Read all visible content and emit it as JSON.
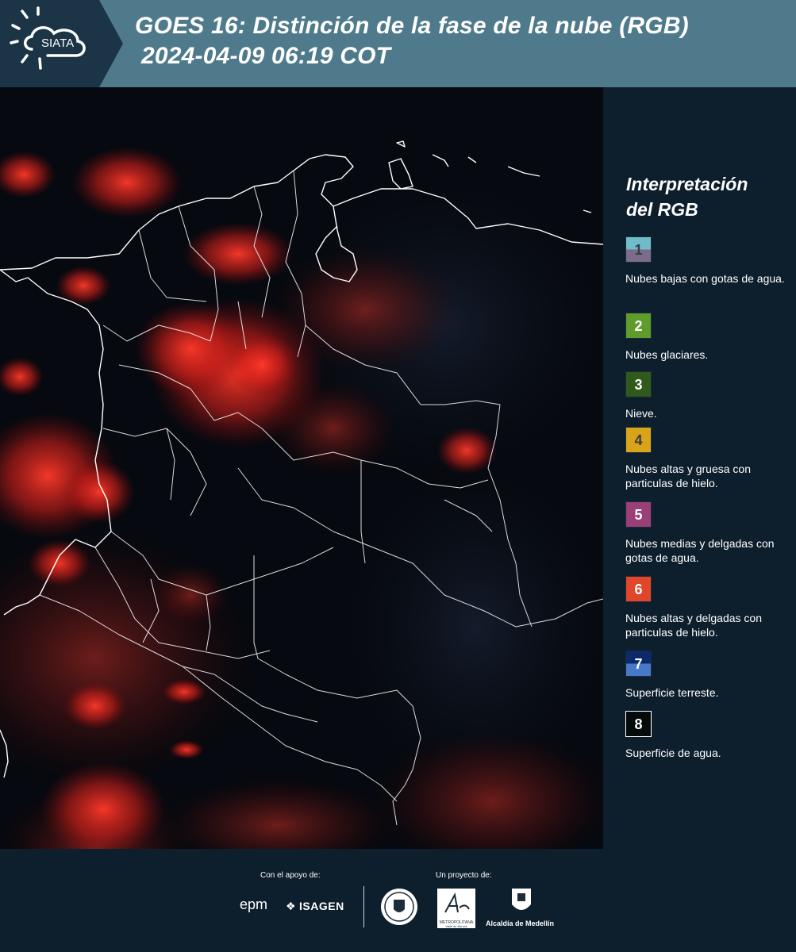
{
  "header": {
    "logo_text": "SIATA",
    "title_line1": "GOES 16: Distinción de la fase de la nube (RGB)",
    "title_line2": "2024-04-09 06:19 COT"
  },
  "legend": {
    "title_line1": "Interpretación",
    "title_line2": "del RGB",
    "items": [
      {
        "num": "1",
        "text": "Nubes bajas con gotas de agua.",
        "color_top": "#6fbccb",
        "color_bottom": "#7b6d8a",
        "num_color": "#3a3a44"
      },
      {
        "num": "2",
        "text": "Nubes glaciares.",
        "color_top": "#5f9c2c",
        "color_bottom": "#5f9c2c",
        "num_color": "#ffffff"
      },
      {
        "num": "3",
        "text": "Nieve.",
        "color_top": "#2f5a1c",
        "color_bottom": "#2f5a1c",
        "num_color": "#ffffff"
      },
      {
        "num": "4",
        "text": "Nubes altas y gruesa con particulas de hielo.",
        "color_top": "#d9a41a",
        "color_bottom": "#d9a41a",
        "num_color": "#3a3a44"
      },
      {
        "num": "5",
        "text": "Nubes medias y delgadas con gotas de agua.",
        "color_top": "#9b3f78",
        "color_bottom": "#9b3f78",
        "num_color": "#ffffff"
      },
      {
        "num": "6",
        "text": "Nubes altas y delgadas con particulas de hielo.",
        "color_top": "#e2462a",
        "color_bottom": "#e2462a",
        "num_color": "#ffffff"
      },
      {
        "num": "7",
        "text": "Superficie terreste.",
        "color_top": "#0c2a6b",
        "color_bottom": "#4a78c8",
        "num_color": "#ffffff"
      },
      {
        "num": "8",
        "text": "Superficie de agua.",
        "color_top": "#050a0a",
        "color_bottom": "#050a0a",
        "num_color": "#ffffff"
      }
    ]
  },
  "footer": {
    "support_label": "Con el apoyo de:",
    "support_brand_1": "epm",
    "support_brand_2": "ISAGEN",
    "project_label": "Un proyecto de:",
    "area_caption": "METROPOLITANA",
    "area_sub": "Valle de Aburrá",
    "medellin_label": "Alcaldía de Medellín"
  },
  "colors": {
    "header_bg": "#4e7a8b",
    "panel_bg": "#0d1e2d",
    "cloud_red": "#ff2a1a",
    "border_white": "#ffffff"
  }
}
